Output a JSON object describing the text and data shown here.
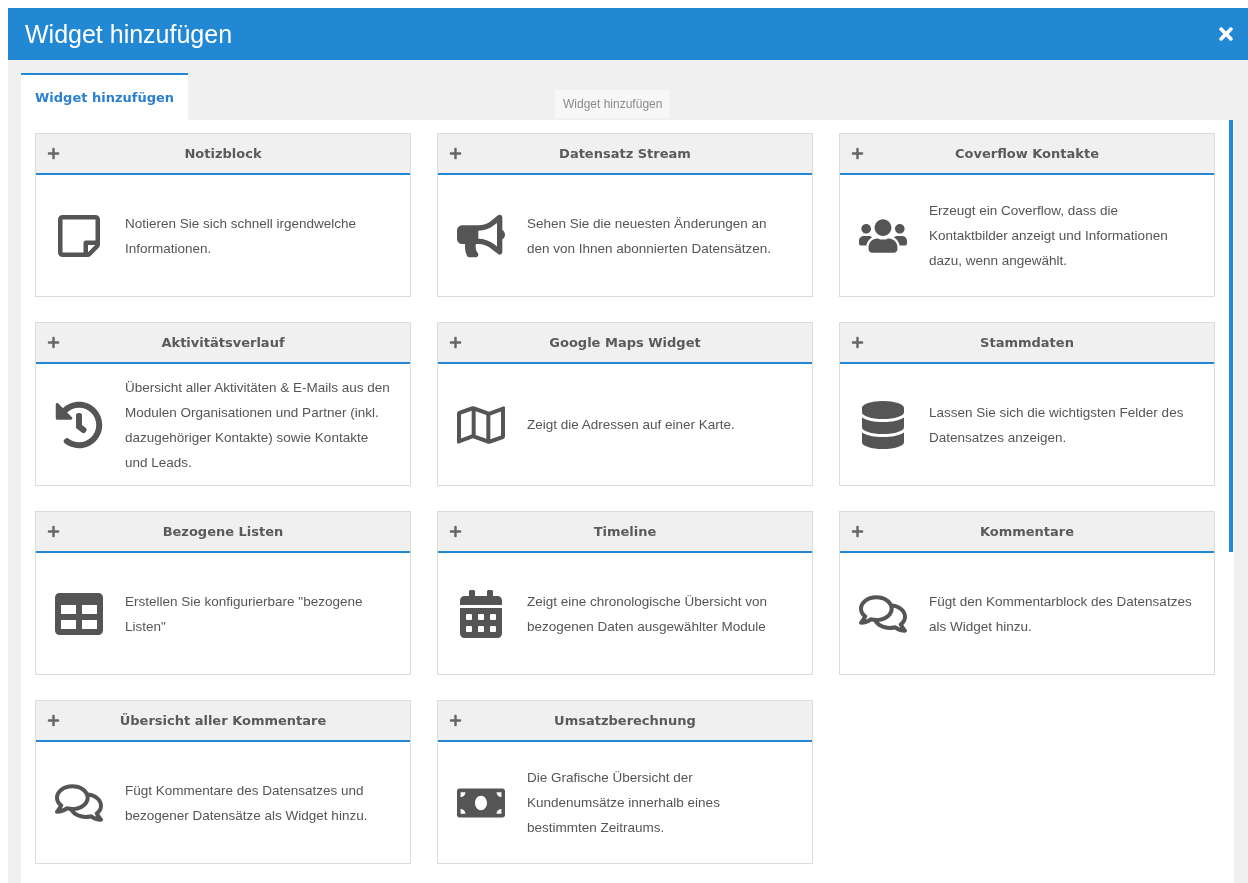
{
  "dialog": {
    "title": "Widget hinzufügen"
  },
  "tabs": [
    {
      "label": "Widget hinzufügen",
      "selected": true
    }
  ],
  "tooltip": "Widget hinzufügen",
  "widgets": [
    {
      "title": "Notizblock",
      "kind": "note",
      "description": "Notieren Sie sich schnell irgendwelche Informationen."
    },
    {
      "title": "Datensatz Stream",
      "kind": "megaphone",
      "description": "Sehen Sie die neuesten Änderungen an den von Ihnen abonnierten Datensätzen."
    },
    {
      "title": "Coverflow Kontakte",
      "kind": "users",
      "description": "Erzeugt ein Coverflow, dass die Kontaktbilder anzeigt und Informationen dazu, wenn angewählt."
    },
    {
      "title": "Aktivitätsverlauf",
      "kind": "history",
      "description": "Übersicht aller Aktivitäten & E-Mails aus den Modulen Organisationen und Partner (inkl. dazugehöriger Kontakte) sowie Kontakte und Leads."
    },
    {
      "title": "Google Maps Widget",
      "kind": "map",
      "description": "Zeigt die Adressen auf einer Karte."
    },
    {
      "title": "Stammdaten",
      "kind": "database",
      "description": "Lassen Sie sich die wichtigsten Felder des Datensatzes anzeigen."
    },
    {
      "title": "Bezogene Listen",
      "kind": "table",
      "description": "Erstellen Sie konfigurierbare \"bezogene Listen\""
    },
    {
      "title": "Timeline",
      "kind": "calendar",
      "description": "Zeigt eine chronologische Übersicht von bezogenen Daten ausgewählter Module"
    },
    {
      "title": "Kommentare",
      "kind": "comments",
      "description": "Fügt den Kommentarblock des Datensatzes als Widget hinzu."
    },
    {
      "title": "Übersicht aller Kommentare",
      "kind": "comments",
      "description": "Fügt Kommentare des Datensatzes und bezogener Datensätze als Widget hinzu."
    },
    {
      "title": "Umsatzberechnung",
      "kind": "money",
      "description": "Die Grafische Übersicht der Kundenumsätze innerhalb eines bestimmten Zeitraums."
    }
  ]
}
